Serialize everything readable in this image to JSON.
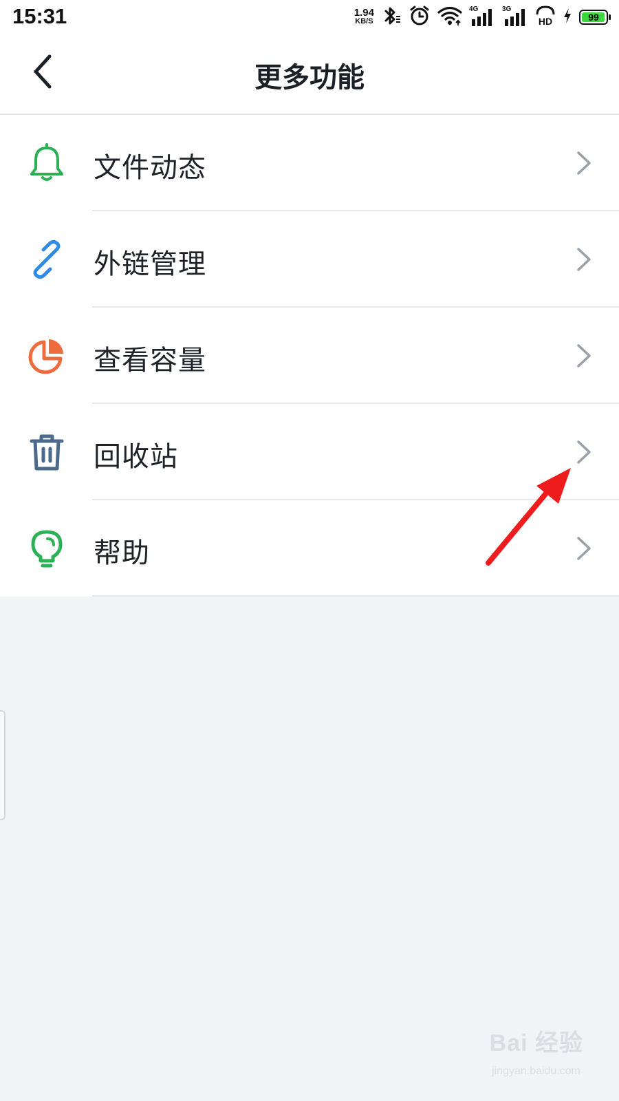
{
  "status_bar": {
    "time": "15:31",
    "net_speed_value": "1.94",
    "net_speed_unit": "KB/S",
    "signal_1_tag": "4G",
    "signal_2_tag": "3G",
    "battery_level": "99",
    "battery_fraction": 0.99,
    "icons": [
      "bluetooth-icon",
      "alarm-icon",
      "wifi-icon",
      "signal-4g-icon",
      "signal-3g-icon",
      "hd-icon",
      "charging-icon",
      "battery-icon"
    ]
  },
  "header": {
    "title": "更多功能",
    "back_icon": "chevron-left-icon"
  },
  "menu": {
    "items": [
      {
        "label": "文件动态",
        "icon": "bell-icon",
        "color": "#2bb055"
      },
      {
        "label": "外链管理",
        "icon": "link-icon",
        "color": "#2f8ae8"
      },
      {
        "label": "查看容量",
        "icon": "pie-chart-icon",
        "color": "#ee6b3d"
      },
      {
        "label": "回收站",
        "icon": "trash-icon",
        "color": "#4c6a8c"
      },
      {
        "label": "帮助",
        "icon": "lightbulb-icon",
        "color": "#2bb055"
      }
    ],
    "chevron_color": "#9aa0a8"
  },
  "annotation": {
    "arrow_color": "#ee1c1c"
  },
  "watermark": {
    "text": "Bai 经验",
    "subtext": "jingyan.baidu.com"
  }
}
